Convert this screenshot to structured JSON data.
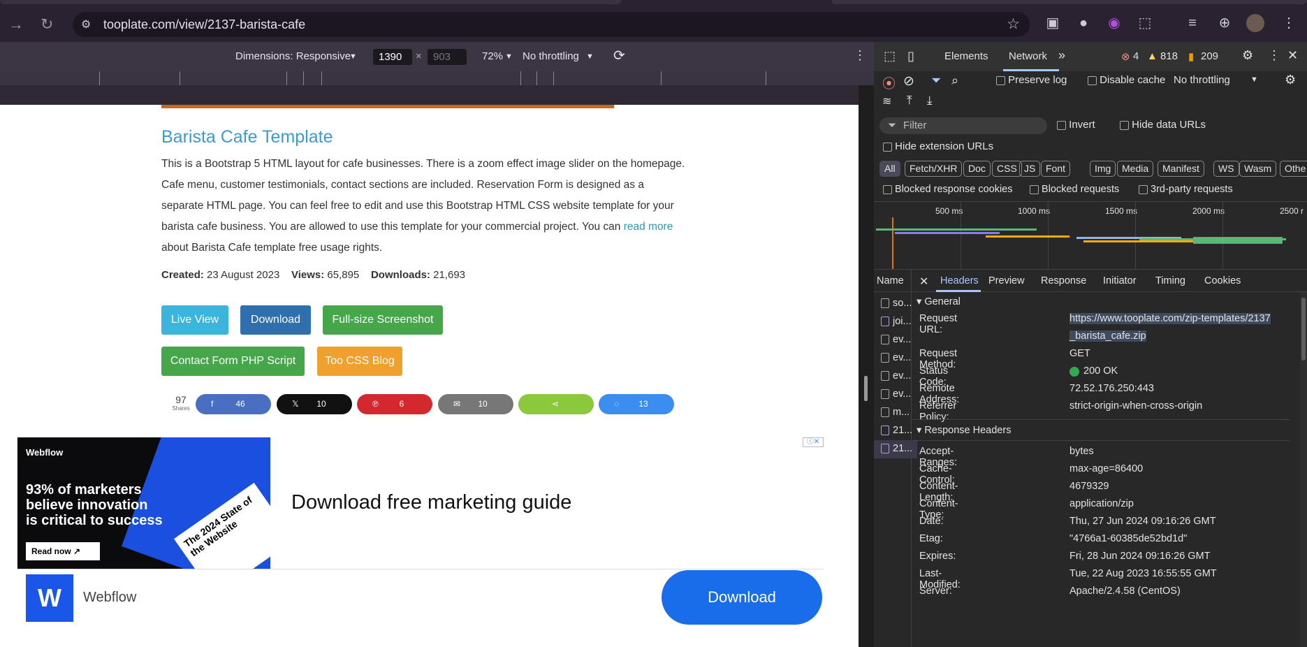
{
  "browser": {
    "url": "tooplate.com/view/2137-barista-cafe"
  },
  "device_toolbar": {
    "dimensions_label": "Dimensions: Responsive",
    "width": "1390",
    "height": "903",
    "zoom": "72%",
    "throttling": "No throttling"
  },
  "page": {
    "title": "Barista Cafe Template",
    "desc_before_link": "This is a Bootstrap 5 HTML layout for cafe businesses. There is a zoom effect image slider on the homepage. Cafe menu, customer testimonials, contact sections are included. Reservation Form is designed as a separate HTML page. You can feel free to edit and use this Bootstrap HTML CSS website template for your barista cafe business. You are allowed to use this template for your commercial project. You can ",
    "desc_link": "read more",
    "desc_after_link": " about Barista Cafe template free usage rights.",
    "created_label": "Created:",
    "created_value": "23 August 2023",
    "views_label": "Views:",
    "views_value": "65,895",
    "downloads_label": "Downloads:",
    "downloads_value": "21,693",
    "buttons": {
      "live_view": "Live View",
      "download": "Download",
      "screenshot": "Full-size Screenshot",
      "php": "Contact Form PHP Script",
      "blog": "Too CSS Blog"
    },
    "shares": {
      "total": "97",
      "label": "Shares",
      "facebook": "46",
      "x": "10",
      "pinterest": "6",
      "email": "10",
      "messenger": "13"
    },
    "ad": {
      "brand": "Webflow",
      "image_line1": "93% of marketers",
      "image_line2": "believe innovation",
      "image_line3": "is critical to success",
      "image_cta": "Read now ↗",
      "image_card": "The 2024 State of the Website",
      "headline": "Download free marketing guide",
      "advertiser": "Webflow",
      "cta": "Download"
    }
  },
  "devtools": {
    "tabs": [
      "Elements",
      "Network"
    ],
    "errors": "4",
    "warnings": "818",
    "issues": "209",
    "preserve_log": "Preserve log",
    "disable_cache": "Disable cache",
    "throttling": "No throttling",
    "filter_placeholder": "Filter",
    "invert": "Invert",
    "hide_data_urls": "Hide data URLs",
    "hide_extension_urls": "Hide extension URLs",
    "types": [
      "All",
      "Fetch/XHR",
      "Doc",
      "CSS",
      "JS",
      "Font",
      "Img",
      "Media",
      "Manifest",
      "WS",
      "Wasm",
      "Othe"
    ],
    "blocked_cookies": "Blocked response cookies",
    "blocked_requests": "Blocked requests",
    "third_party": "3rd-party requests",
    "timeline_ticks": [
      "500 ms",
      "1000 ms",
      "1500 ms",
      "2000 ms",
      "2500 r"
    ],
    "name_col": "Name",
    "requests": [
      "so...",
      "joi...",
      "ev...",
      "ev...",
      "ev...",
      "ev...",
      "m...",
      "21...",
      "21..."
    ],
    "detail_tabs": [
      "Headers",
      "Preview",
      "Response",
      "Initiator",
      "Timing",
      "Cookies"
    ],
    "general_title": "General",
    "general": [
      {
        "k": "Request URL:",
        "v": "https://www.tooplate.com/zip-templates/2137",
        "v2": "_barista_cafe.zip"
      },
      {
        "k": "Request Method:",
        "v": "GET"
      },
      {
        "k": "Status Code:",
        "v": "200 OK"
      },
      {
        "k": "Remote Address:",
        "v": "72.52.176.250:443"
      },
      {
        "k": "Referrer Policy:",
        "v": "strict-origin-when-cross-origin"
      }
    ],
    "response_title": "Response Headers",
    "response": [
      {
        "k": "Accept-Ranges:",
        "v": "bytes"
      },
      {
        "k": "Cache-Control:",
        "v": "max-age=86400"
      },
      {
        "k": "Content-Length:",
        "v": "4679329"
      },
      {
        "k": "Content-Type:",
        "v": "application/zip"
      },
      {
        "k": "Date:",
        "v": "Thu, 27 Jun 2024 09:16:26 GMT"
      },
      {
        "k": "Etag:",
        "v": "\"4766a1-60385de52bd1d\""
      },
      {
        "k": "Expires:",
        "v": "Fri, 28 Jun 2024 09:16:26 GMT"
      },
      {
        "k": "Last-Modified:",
        "v": "Tue, 22 Aug 2023 16:55:55 GMT"
      },
      {
        "k": "Server:",
        "v": "Apache/2.4.58 (CentOS)"
      }
    ]
  }
}
